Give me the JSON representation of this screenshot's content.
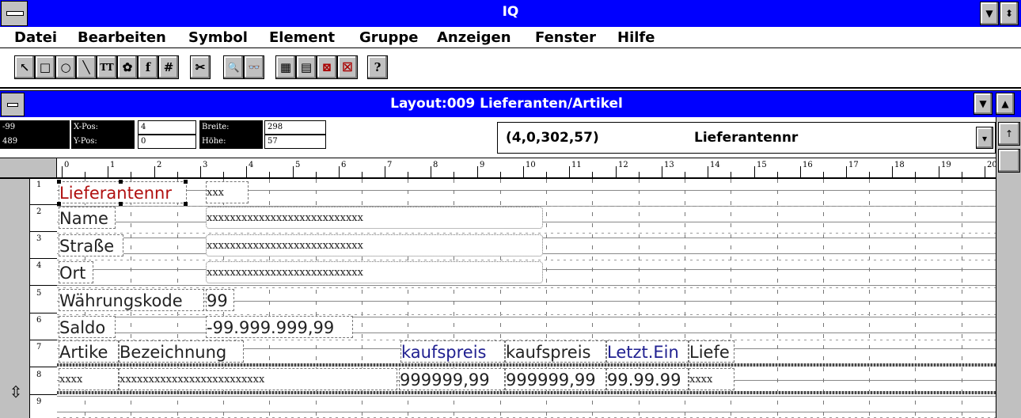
{
  "app": {
    "title": "IQ",
    "sysmenu_icon": "minus-bar-icon",
    "min_label": "▼",
    "restore_label": "⬍"
  },
  "menu": [
    {
      "label": "Datei"
    },
    {
      "label": "Bearbeiten"
    },
    {
      "label": "Symbol"
    },
    {
      "label": "Element"
    },
    {
      "label": "Gruppe"
    },
    {
      "label": "Anzeigen"
    },
    {
      "label": "Fenster"
    },
    {
      "label": "Hilfe"
    }
  ],
  "toolbar": [
    {
      "icon": "arrow-pointer-icon",
      "glyph": "↖"
    },
    {
      "icon": "rectangle-icon",
      "glyph": "□"
    },
    {
      "icon": "circle-icon",
      "glyph": "○"
    },
    {
      "icon": "line-icon",
      "glyph": "╲"
    },
    {
      "icon": "text-tool-icon",
      "glyph": "TT"
    },
    {
      "icon": "picture-tool-icon",
      "glyph": "✿"
    },
    {
      "icon": "function-icon",
      "glyph": "f"
    },
    {
      "icon": "hash-field-icon",
      "glyph": "#"
    },
    {
      "icon": "scissors-icon",
      "glyph": "✂"
    },
    {
      "icon": "zoom-icon",
      "glyph": "🔍"
    },
    {
      "icon": "glasses-icon",
      "glyph": "👓"
    },
    {
      "icon": "layout-grid-icon",
      "glyph": "▦"
    },
    {
      "icon": "window-stack-icon",
      "glyph": "▤"
    },
    {
      "icon": "delete-picture-icon",
      "glyph": "⊠"
    },
    {
      "icon": "delete-icon",
      "glyph": "☒"
    },
    {
      "icon": "help-icon",
      "glyph": "?"
    }
  ],
  "child": {
    "title": "Layout:009  Lieferanten/Artikel"
  },
  "position": {
    "left_top": "-99",
    "left_bottom": "489",
    "xpos_label": "X-Pos:",
    "ypos_label": "Y-Pos:",
    "xpos_value": "4",
    "ypos_value": "0",
    "width_label": "Breite:",
    "height_label": "Höhe:",
    "width_value": "298",
    "height_value": "57",
    "coords": "(4,0,302,57)",
    "field_name": "Lieferantennr"
  },
  "ruler": [
    "0",
    "1",
    "2",
    "3",
    "4",
    "5",
    "6",
    "7",
    "8",
    "9",
    "10",
    "11",
    "12",
    "13",
    "14",
    "15",
    "16",
    "17",
    "18",
    "19",
    "20"
  ],
  "rows": [
    "1",
    "2",
    "3",
    "4",
    "5",
    "6",
    "7",
    "8",
    "9"
  ],
  "layout": {
    "r1_label": "Lieferantennr",
    "r1_value": "xxx",
    "r2_label": "Name",
    "r2_value": "xxxxxxxxxxxxxxxxxxxxxxxxxxx",
    "r3_label": "Straße",
    "r3_value": "xxxxxxxxxxxxxxxxxxxxxxxxxxx",
    "r4_label": "Ort",
    "r4_value": "xxxxxxxxxxxxxxxxxxxxxxxxxxx",
    "r5_label": "Währungskode",
    "r5_value": "99",
    "r6_label": "Saldo",
    "r6_value": "-99.999.999,99",
    "r7_col1": "Artike",
    "r7_col2": "Bezeichnung",
    "r7_col3": "kaufspreis",
    "r7_col4": "kaufspreis",
    "r7_col5": "Letzt.Ein",
    "r7_col6": "Liefe",
    "r8_col1": "xxxx",
    "r8_col2": "xxxxxxxxxxxxxxxxxxxxxxxxx",
    "r8_col3": "999999,99",
    "r8_col4": "999999,99",
    "r8_col5": "99.99.99",
    "r8_col6": "xxxx"
  }
}
